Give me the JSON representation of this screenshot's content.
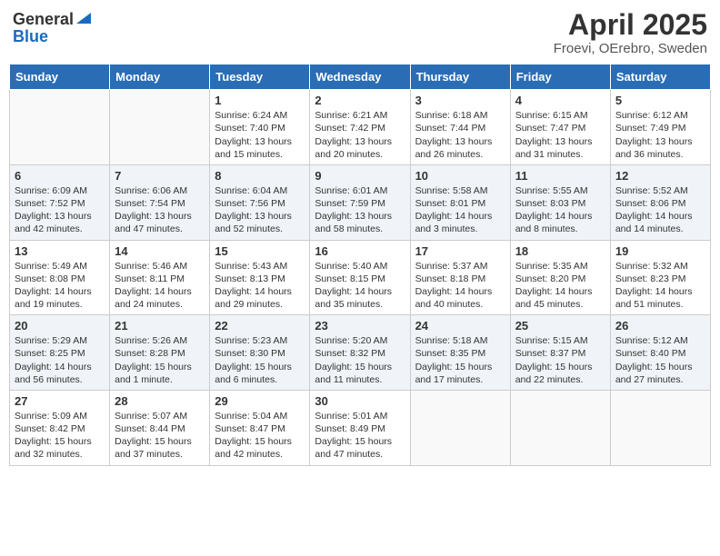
{
  "header": {
    "logo_general": "General",
    "logo_blue": "Blue",
    "title": "April 2025",
    "subtitle": "Froevi, OErebro, Sweden"
  },
  "days_of_week": [
    "Sunday",
    "Monday",
    "Tuesday",
    "Wednesday",
    "Thursday",
    "Friday",
    "Saturday"
  ],
  "weeks": [
    [
      {
        "day": "",
        "info": ""
      },
      {
        "day": "",
        "info": ""
      },
      {
        "day": "1",
        "info": "Sunrise: 6:24 AM\nSunset: 7:40 PM\nDaylight: 13 hours and 15 minutes."
      },
      {
        "day": "2",
        "info": "Sunrise: 6:21 AM\nSunset: 7:42 PM\nDaylight: 13 hours and 20 minutes."
      },
      {
        "day": "3",
        "info": "Sunrise: 6:18 AM\nSunset: 7:44 PM\nDaylight: 13 hours and 26 minutes."
      },
      {
        "day": "4",
        "info": "Sunrise: 6:15 AM\nSunset: 7:47 PM\nDaylight: 13 hours and 31 minutes."
      },
      {
        "day": "5",
        "info": "Sunrise: 6:12 AM\nSunset: 7:49 PM\nDaylight: 13 hours and 36 minutes."
      }
    ],
    [
      {
        "day": "6",
        "info": "Sunrise: 6:09 AM\nSunset: 7:52 PM\nDaylight: 13 hours and 42 minutes."
      },
      {
        "day": "7",
        "info": "Sunrise: 6:06 AM\nSunset: 7:54 PM\nDaylight: 13 hours and 47 minutes."
      },
      {
        "day": "8",
        "info": "Sunrise: 6:04 AM\nSunset: 7:56 PM\nDaylight: 13 hours and 52 minutes."
      },
      {
        "day": "9",
        "info": "Sunrise: 6:01 AM\nSunset: 7:59 PM\nDaylight: 13 hours and 58 minutes."
      },
      {
        "day": "10",
        "info": "Sunrise: 5:58 AM\nSunset: 8:01 PM\nDaylight: 14 hours and 3 minutes."
      },
      {
        "day": "11",
        "info": "Sunrise: 5:55 AM\nSunset: 8:03 PM\nDaylight: 14 hours and 8 minutes."
      },
      {
        "day": "12",
        "info": "Sunrise: 5:52 AM\nSunset: 8:06 PM\nDaylight: 14 hours and 14 minutes."
      }
    ],
    [
      {
        "day": "13",
        "info": "Sunrise: 5:49 AM\nSunset: 8:08 PM\nDaylight: 14 hours and 19 minutes."
      },
      {
        "day": "14",
        "info": "Sunrise: 5:46 AM\nSunset: 8:11 PM\nDaylight: 14 hours and 24 minutes."
      },
      {
        "day": "15",
        "info": "Sunrise: 5:43 AM\nSunset: 8:13 PM\nDaylight: 14 hours and 29 minutes."
      },
      {
        "day": "16",
        "info": "Sunrise: 5:40 AM\nSunset: 8:15 PM\nDaylight: 14 hours and 35 minutes."
      },
      {
        "day": "17",
        "info": "Sunrise: 5:37 AM\nSunset: 8:18 PM\nDaylight: 14 hours and 40 minutes."
      },
      {
        "day": "18",
        "info": "Sunrise: 5:35 AM\nSunset: 8:20 PM\nDaylight: 14 hours and 45 minutes."
      },
      {
        "day": "19",
        "info": "Sunrise: 5:32 AM\nSunset: 8:23 PM\nDaylight: 14 hours and 51 minutes."
      }
    ],
    [
      {
        "day": "20",
        "info": "Sunrise: 5:29 AM\nSunset: 8:25 PM\nDaylight: 14 hours and 56 minutes."
      },
      {
        "day": "21",
        "info": "Sunrise: 5:26 AM\nSunset: 8:28 PM\nDaylight: 15 hours and 1 minute."
      },
      {
        "day": "22",
        "info": "Sunrise: 5:23 AM\nSunset: 8:30 PM\nDaylight: 15 hours and 6 minutes."
      },
      {
        "day": "23",
        "info": "Sunrise: 5:20 AM\nSunset: 8:32 PM\nDaylight: 15 hours and 11 minutes."
      },
      {
        "day": "24",
        "info": "Sunrise: 5:18 AM\nSunset: 8:35 PM\nDaylight: 15 hours and 17 minutes."
      },
      {
        "day": "25",
        "info": "Sunrise: 5:15 AM\nSunset: 8:37 PM\nDaylight: 15 hours and 22 minutes."
      },
      {
        "day": "26",
        "info": "Sunrise: 5:12 AM\nSunset: 8:40 PM\nDaylight: 15 hours and 27 minutes."
      }
    ],
    [
      {
        "day": "27",
        "info": "Sunrise: 5:09 AM\nSunset: 8:42 PM\nDaylight: 15 hours and 32 minutes."
      },
      {
        "day": "28",
        "info": "Sunrise: 5:07 AM\nSunset: 8:44 PM\nDaylight: 15 hours and 37 minutes."
      },
      {
        "day": "29",
        "info": "Sunrise: 5:04 AM\nSunset: 8:47 PM\nDaylight: 15 hours and 42 minutes."
      },
      {
        "day": "30",
        "info": "Sunrise: 5:01 AM\nSunset: 8:49 PM\nDaylight: 15 hours and 47 minutes."
      },
      {
        "day": "",
        "info": ""
      },
      {
        "day": "",
        "info": ""
      },
      {
        "day": "",
        "info": ""
      }
    ]
  ]
}
